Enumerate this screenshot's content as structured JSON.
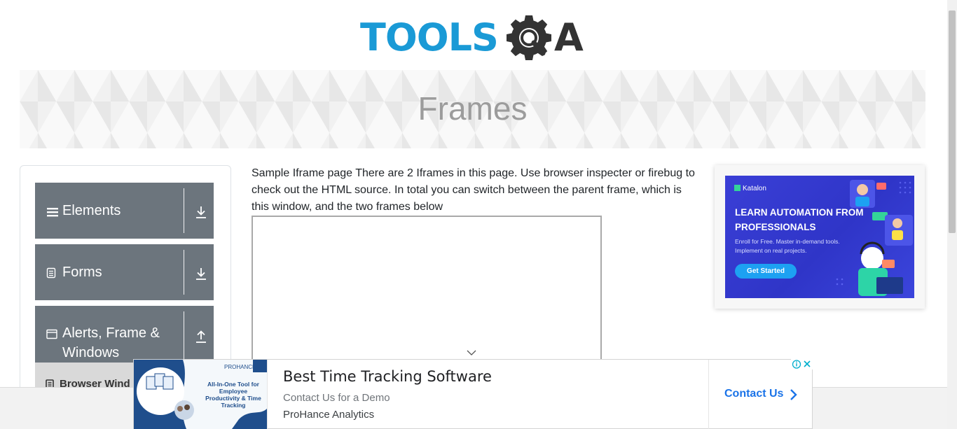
{
  "logo": {
    "text": "TOOLS",
    "suffix": "A",
    "icon": "gear-magnifier-icon",
    "colors": {
      "primary": "#1a9ad6",
      "dark": "#333333"
    }
  },
  "banner": {
    "title": "Frames"
  },
  "sidebar": {
    "groups": [
      {
        "label": "Elements",
        "icon": "hamburger-icon",
        "arrow": "arrow-down-icon"
      },
      {
        "label": "Forms",
        "icon": "document-icon",
        "arrow": "arrow-down-icon"
      },
      {
        "label": "Alerts, Frame & Windows",
        "line1": "Alerts, Frame &",
        "line2": "Windows",
        "icon": "window-icon",
        "arrow": "arrow-up-icon"
      }
    ],
    "sub_items": [
      {
        "label": "Browser Windows",
        "visible_text": "Browser Wind"
      }
    ],
    "header_color": "#6c757d"
  },
  "main": {
    "description": "Sample Iframe page There are 2 Iframes in this page. Use browser inspecter or firebug to check out the HTML source. In total you can switch between the parent frame, which is this window, and the two frames below"
  },
  "side_ad": {
    "brand": "Katalon",
    "headline": "LEARN AUTOMATION FROM PROFESSIONALS",
    "subtext": "Enroll for Free. Master in-demand tools. Implement on real projects.",
    "cta": "Get Started",
    "colors": {
      "background": "#3a3fd6",
      "cta": "#1da1f2"
    }
  },
  "bottom_ad": {
    "image_brand": "PROHANCE",
    "image_caption": "All-In-One Tool for Employee Productivity & Time Tracking",
    "title": "Best Time Tracking Software",
    "subtitle": "Contact Us for a Demo",
    "advertiser": "ProHance Analytics",
    "cta": "Contact Us",
    "colors": {
      "cta": "#1a73e8"
    }
  }
}
